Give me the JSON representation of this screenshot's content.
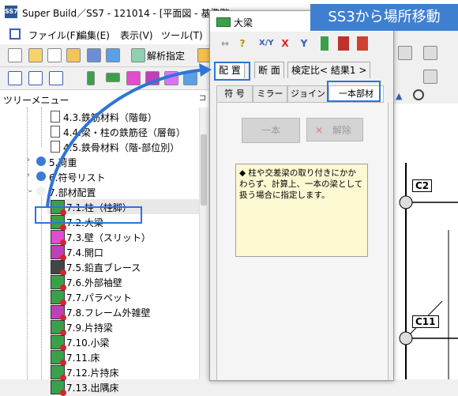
{
  "window": {
    "title": "Super Build／SS7 - 121014 - [平面図 - 基準階",
    "app_icon_text": "SS7"
  },
  "menu": [
    "ファイル(F)",
    "編集(E)",
    "表示(V)",
    "ツール(T)"
  ],
  "toolbar1": {
    "layout_label": "解析指定"
  },
  "tree": {
    "title": "ツリーメニュー",
    "items": [
      {
        "label": "4.3.鉄筋材料（階毎）",
        "indent": 2,
        "kind": "doc"
      },
      {
        "label": "4.4.梁・柱の鉄筋径（層毎）",
        "indent": 2,
        "kind": "doc"
      },
      {
        "label": "4.5.鉄骨材料（階-部位別）",
        "indent": 2,
        "kind": "doc"
      },
      {
        "label": "5.荷重",
        "indent": 1,
        "kind": "group"
      },
      {
        "label": "6.符号リスト",
        "indent": 1,
        "kind": "group"
      },
      {
        "label": "7.部材配置",
        "indent": 1,
        "kind": "group-open"
      },
      {
        "label": "7.1.柱（柱脚）",
        "indent": 2,
        "kind": "column"
      },
      {
        "label": "7.2.大梁",
        "indent": 2,
        "kind": "beam"
      },
      {
        "label": "7.3.壁（スリット）",
        "indent": 2,
        "kind": "wall"
      },
      {
        "label": "7.4.開口",
        "indent": 2,
        "kind": "opening"
      },
      {
        "label": "7.5.鉛直ブレース",
        "indent": 2,
        "kind": "brace"
      },
      {
        "label": "7.6.外部袖壁",
        "indent": 2,
        "kind": "sidewall"
      },
      {
        "label": "7.7.パラペット",
        "indent": 2,
        "kind": "parapet"
      },
      {
        "label": "7.8.フレーム外雑壁",
        "indent": 2,
        "kind": "miscwall"
      },
      {
        "label": "7.9.片持梁",
        "indent": 2,
        "kind": "cantibeam"
      },
      {
        "label": "7.10.小梁",
        "indent": 2,
        "kind": "smallbeam"
      },
      {
        "label": "7.11.床",
        "indent": 2,
        "kind": "floor"
      },
      {
        "label": "7.12.片持床",
        "indent": 2,
        "kind": "cantifloor"
      },
      {
        "label": "7.13.出隅床",
        "indent": 2,
        "kind": "cornerfloor"
      }
    ]
  },
  "dialog": {
    "title": "大梁",
    "toolbar": [
      "X/Y",
      "X",
      "Y"
    ],
    "tabs": [
      "配 置",
      "断 面",
      "検定比< 結果1 >"
    ],
    "subtabs": [
      "符 号",
      "ミラー",
      "ジョイント",
      "一本部材"
    ],
    "btn_one": "一本",
    "btn_release": "解除",
    "note": "◆ 柱や交差梁の取り付きにかかわらず、計算上、一本の梁として扱う場合に指定します。"
  },
  "canvas": {
    "labels": [
      "C2",
      "C11"
    ]
  },
  "banner": "SS3から場所移動",
  "colors": {
    "accent": "#3f7fd0",
    "highlight": "#2f74d6"
  }
}
